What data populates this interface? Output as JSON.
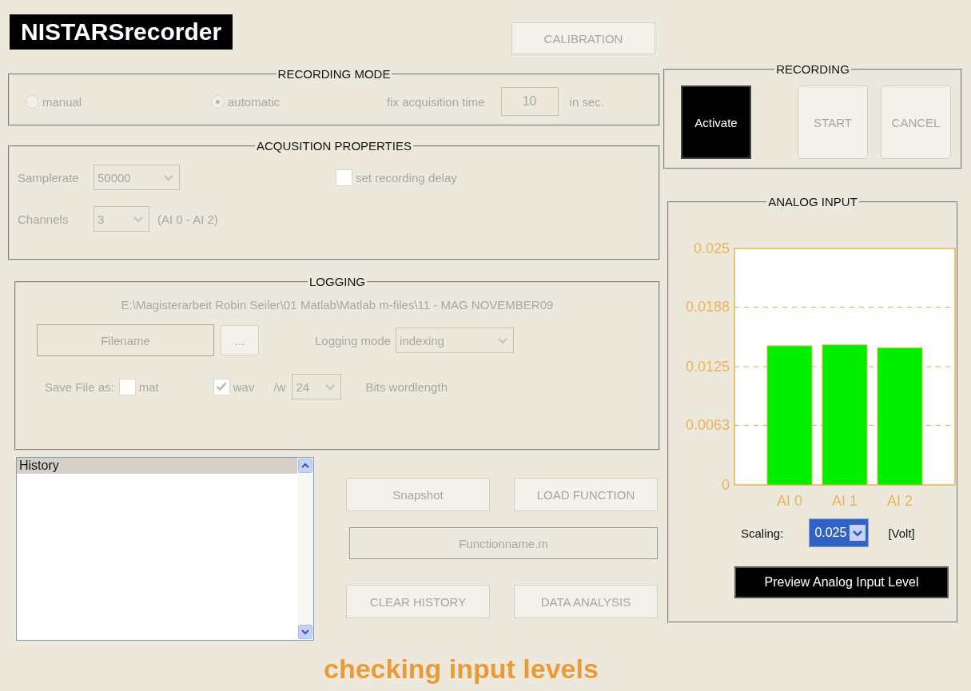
{
  "app_title": "NISTARSrecorder",
  "calibration_button": {
    "label": "CALIBRATION",
    "disabled": true
  },
  "recording_mode": {
    "title": "RECORDING MODE",
    "disabled": true,
    "options": [
      {
        "label": "manual",
        "selected": false
      },
      {
        "label": "automatic",
        "selected": true
      }
    ],
    "time_label": "fix acquisition time",
    "time_value": "10",
    "time_unit": "in sec."
  },
  "acquisition_properties": {
    "title": "ACQUSITION PROPERTIES",
    "disabled": true,
    "samplerate_label": "Samplerate",
    "samplerate_value": "50000",
    "delay": {
      "label": "set recording delay",
      "checked": false
    },
    "channels_label": "Channels",
    "channels_value": "3",
    "channels_note": "(AI 0 - AI 2)"
  },
  "logging": {
    "title": "LOGGING",
    "disabled": true,
    "path": "E:\\Magisterarbeit Robin Seiler\\01 Matlab\\Matlab m-files\\11 - MAG NOVEMBER09",
    "filename_button": "Filename",
    "browse_button": "...",
    "mode_label": "Logging mode",
    "mode_value": "indexing",
    "save_label": "Save File as:",
    "formats": [
      {
        "label": "mat",
        "checked": false
      },
      {
        "label": "wav",
        "checked": true
      }
    ],
    "bits_prefix": "/w",
    "bits_value": "24",
    "bits_label": "Bits wordlength"
  },
  "history": {
    "header": "History"
  },
  "actions": [
    {
      "label": "Snapshot",
      "disabled": true
    },
    {
      "label": "LOAD FUNCTION",
      "disabled": true
    }
  ],
  "function_field": {
    "placeholder": "Functionname.m"
  },
  "actions_bottom": [
    {
      "label": "CLEAR HISTORY",
      "disabled": true
    },
    {
      "label": "DATA ANALYSIS",
      "disabled": true
    }
  ],
  "recording": {
    "title": "RECORDING",
    "buttons": [
      {
        "label": "Activate",
        "kind": "dark",
        "disabled": false
      },
      {
        "label": "START",
        "kind": "plain",
        "disabled": true
      },
      {
        "label": "CANCEL",
        "kind": "plain",
        "disabled": true
      }
    ]
  },
  "analog_input": {
    "title": "ANALOG INPUT",
    "chart_data": {
      "type": "bar",
      "categories": [
        "AI 0",
        "AI 1",
        "AI 2"
      ],
      "series": [
        {
          "color": "#00ee00",
          "values": [
            0.0147,
            0.0148,
            0.0145
          ]
        }
      ],
      "grid": true,
      "ylim": [
        0,
        0.025
      ],
      "yticks": [
        {
          "value": 0,
          "label": "0"
        },
        {
          "value": 0.0063,
          "label": "0.0063"
        },
        {
          "value": 0.0125,
          "label": "0.0125"
        },
        {
          "value": 0.0188,
          "label": "0.0188"
        },
        {
          "value": 0.025,
          "label": "0.025"
        }
      ]
    },
    "scaling_label": "Scaling:",
    "scaling_value": "0.025",
    "scaling_unit": "[Volt]",
    "preview_button": "Preview Analog Input Level"
  },
  "caption": "checking input levels"
}
